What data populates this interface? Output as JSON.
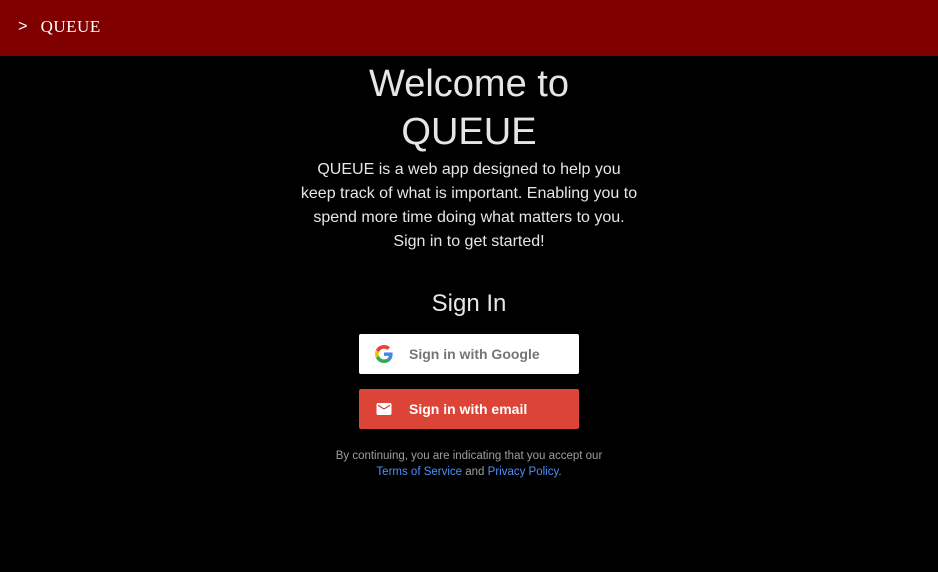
{
  "header": {
    "chevron": ">",
    "app_name": "QUEUE",
    "background_color": "#800000"
  },
  "main": {
    "welcome_title": "Welcome to QUEUE",
    "intro_text": "QUEUE is a web app designed to help you keep track of what is important. Enabling you to spend more time doing what matters to you. Sign in to get started!",
    "signin_heading": "Sign In"
  },
  "auth": {
    "google_label": "Sign in with Google",
    "google_icon": "google-g-icon",
    "email_label": "Sign in with email",
    "email_icon": "mail-icon",
    "email_button_color": "#db4437"
  },
  "legal": {
    "prefix": "By continuing, you are indicating that you accept our",
    "terms_link": "Terms of Service",
    "conjunction": "and",
    "privacy_link": "Privacy Policy",
    "suffix": "."
  }
}
